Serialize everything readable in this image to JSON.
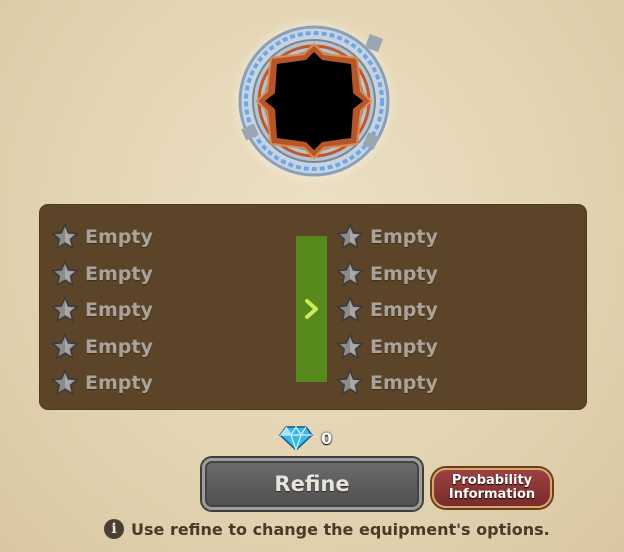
{
  "equipment_slot": {
    "icon": "empty-frame"
  },
  "current_options": [
    {
      "label": "Empty"
    },
    {
      "label": "Empty"
    },
    {
      "label": "Empty"
    },
    {
      "label": "Empty"
    },
    {
      "label": "Empty"
    }
  ],
  "new_options": [
    {
      "label": "Empty"
    },
    {
      "label": "Empty"
    },
    {
      "label": "Empty"
    },
    {
      "label": "Empty"
    },
    {
      "label": "Empty"
    }
  ],
  "transition_icon": "chevron-right-icon",
  "cost": {
    "icon": "diamond-icon",
    "amount": "0"
  },
  "buttons": {
    "refine_label": "Refine",
    "probability_line1": "Probability",
    "probability_line2": "Information"
  },
  "hint": {
    "icon": "info-icon",
    "text": "Use refine to change the equipment's options."
  },
  "colors": {
    "background": "#e6d7b6",
    "panel": "#5c4428",
    "arrow_bar": "#57891d",
    "refine_button": "#5e5e5e",
    "probability_button": "#8c3636"
  }
}
